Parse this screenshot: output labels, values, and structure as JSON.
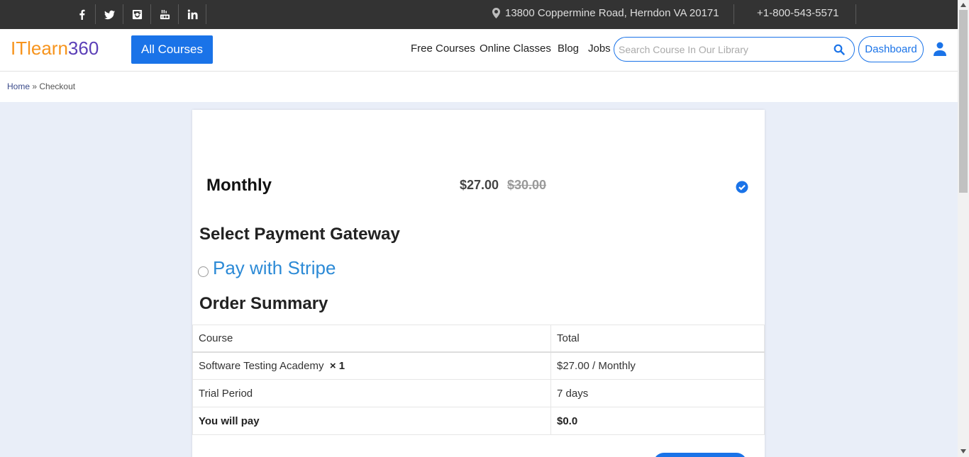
{
  "topbar": {
    "social": [
      "facebook-icon",
      "twitter-icon",
      "instagram-icon",
      "youtube-icon",
      "linkedin-icon"
    ],
    "address": "13800 Coppermine Road, Herndon VA 20171",
    "phone": "+1-800-543-5571"
  },
  "header": {
    "logo_part1": "ITlearn",
    "logo_part2": "360",
    "all_courses": "All Courses",
    "nav": [
      "Free Courses",
      "Online Classes",
      "Blog",
      "Jobs"
    ],
    "search_placeholder": "Search Course In Our Library",
    "dashboard": "Dashboard"
  },
  "breadcrumb": {
    "home": "Home",
    "sep": "»",
    "current": "Checkout"
  },
  "plan": {
    "name": "Monthly",
    "price": "$27.00",
    "old_price": "$30.00"
  },
  "payment": {
    "title": "Select Payment Gateway",
    "stripe_label": "Pay with Stripe"
  },
  "summary": {
    "title": "Order Summary",
    "headers": [
      "Course",
      "Total"
    ],
    "course_name": "Software Testing Academy",
    "course_qty": "× 1",
    "course_total": "$27.00 / Monthly",
    "trial_label": "Trial Period",
    "trial_value": "7 days",
    "pay_label": "You will pay",
    "pay_value": "$0.0"
  },
  "colors": {
    "accent": "#1a73e8",
    "topbar": "#333333",
    "logo_orange": "#f7941d",
    "logo_purple": "#5b3fb7",
    "stripe_link": "#2c8ad6"
  }
}
